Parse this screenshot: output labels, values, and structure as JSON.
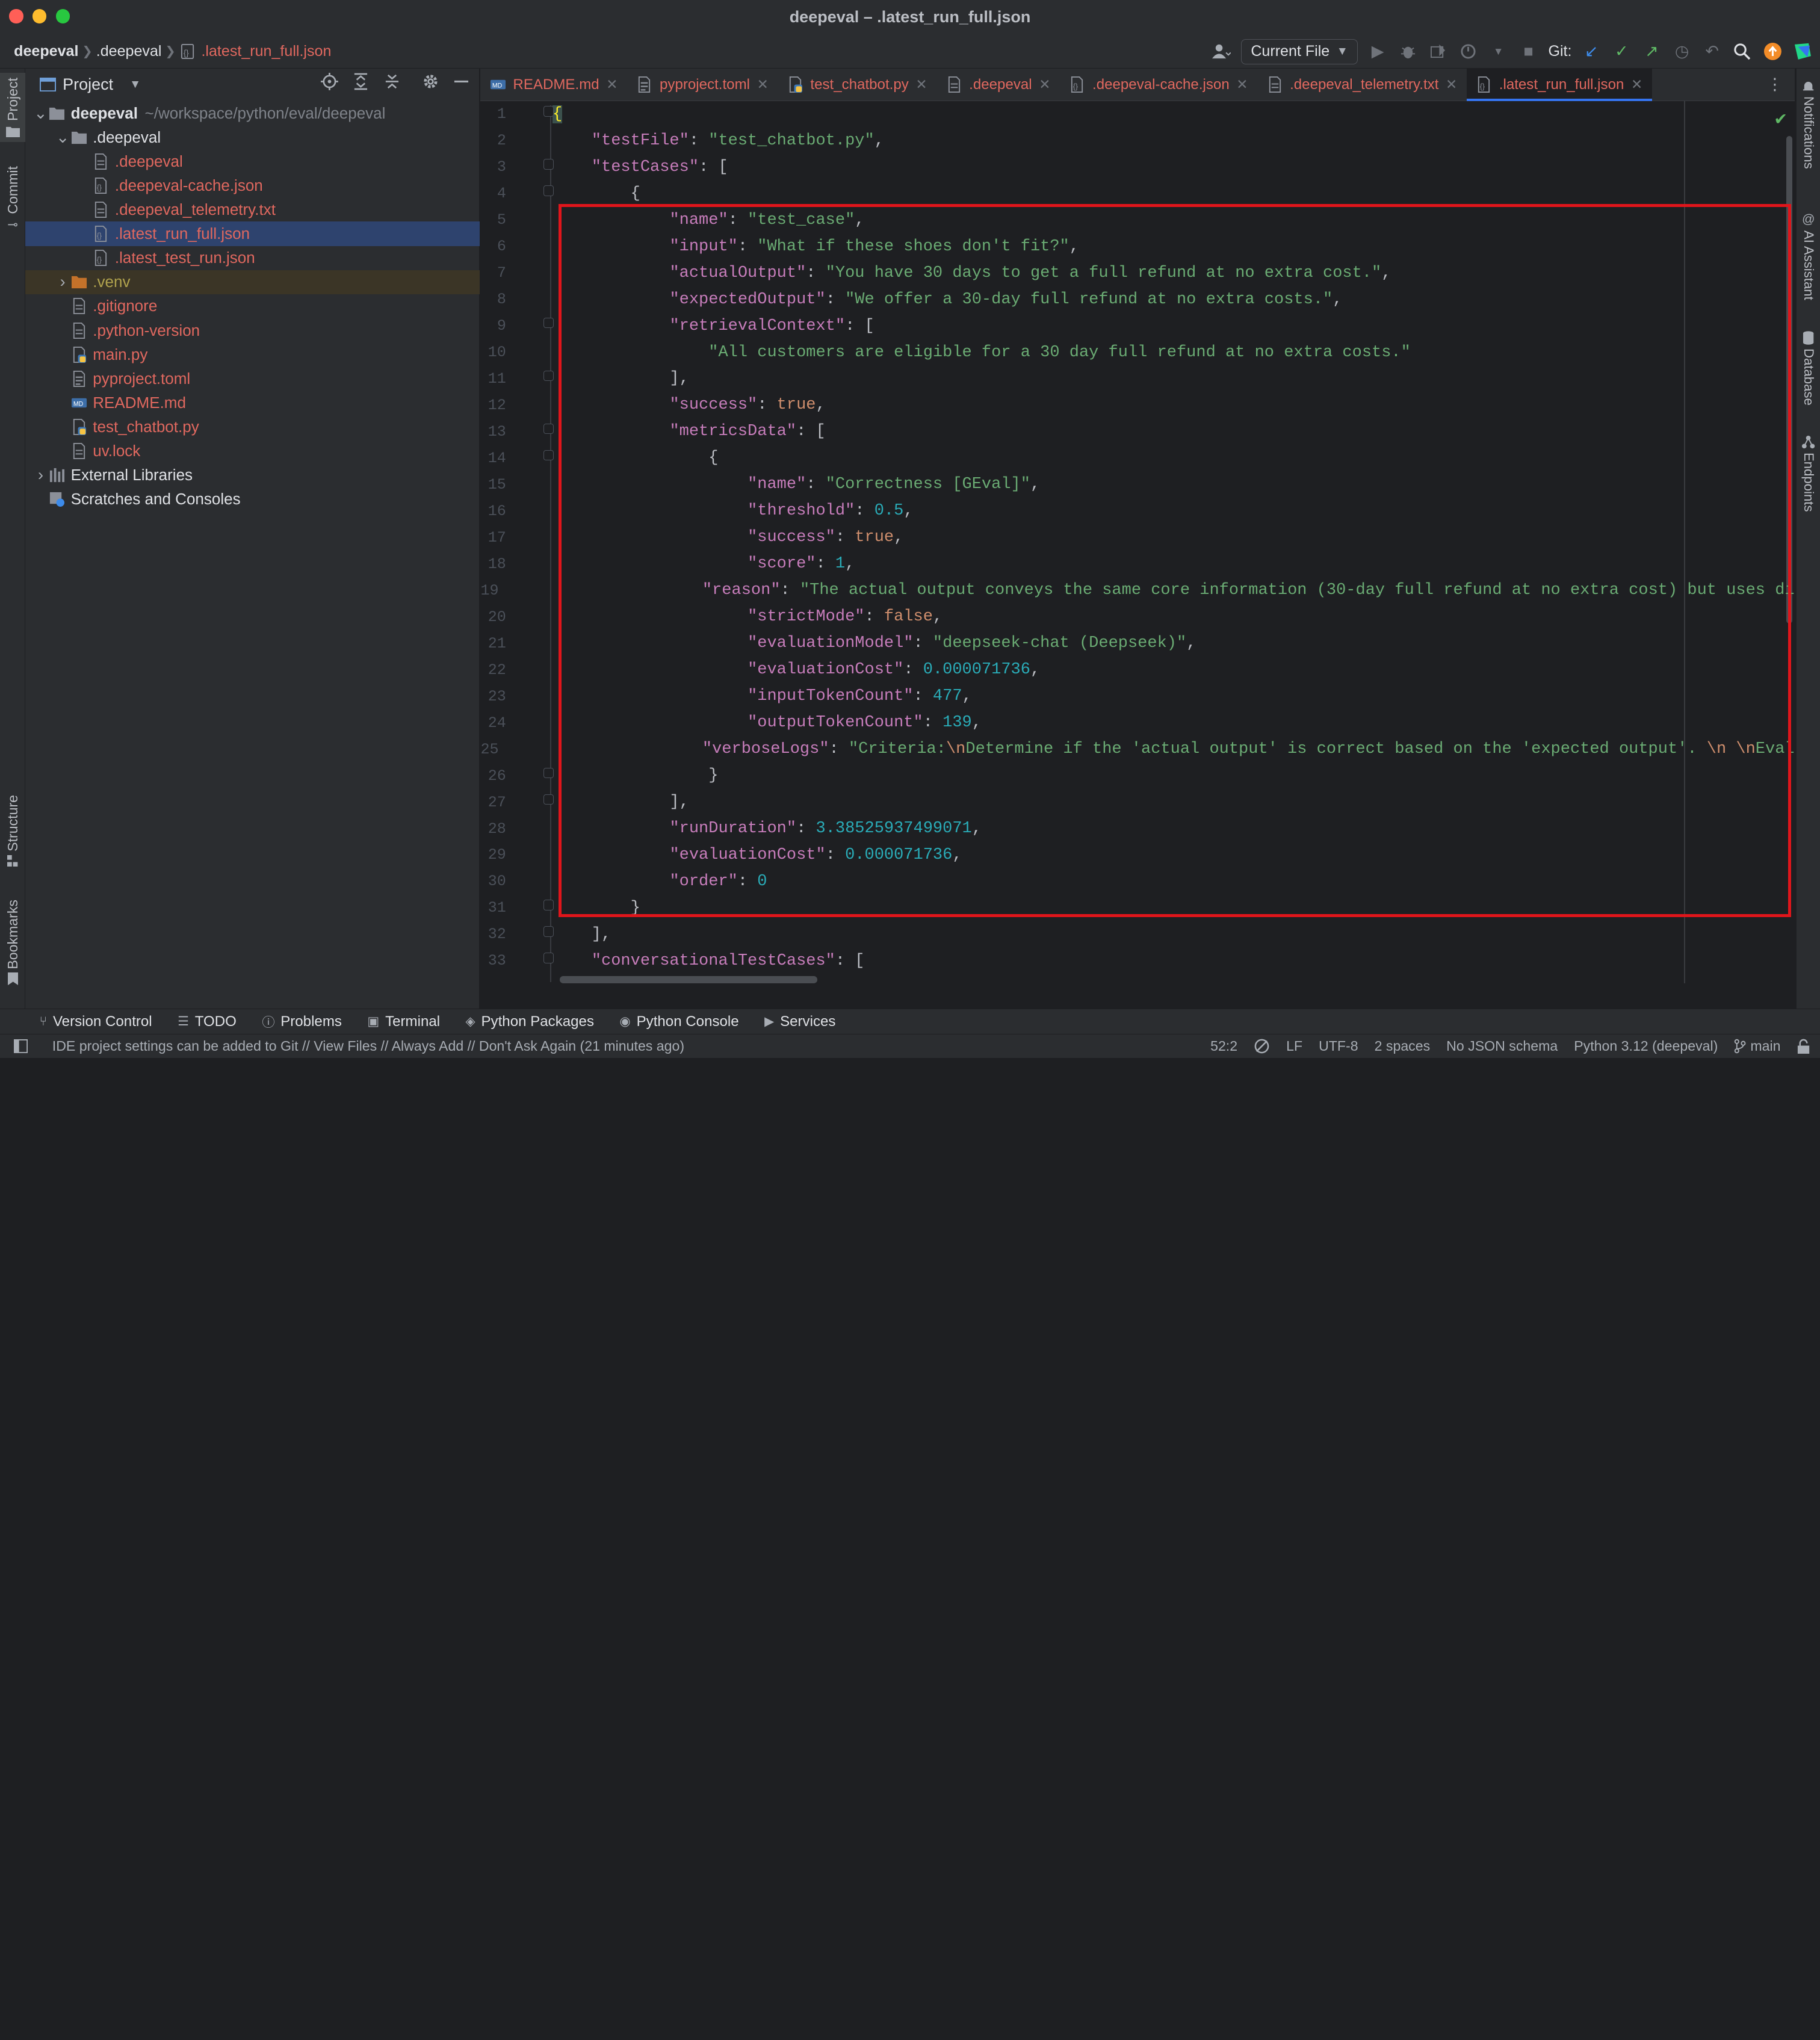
{
  "window": {
    "title": "deepeval – .latest_run_full.json"
  },
  "breadcrumb": {
    "root": "deepeval",
    "folder": ".deepeval",
    "file": ".latest_run_full.json"
  },
  "toolbar": {
    "run_config": "Current File",
    "git_label": "Git:"
  },
  "left_strip": {
    "project": "Project",
    "commit": "Commit",
    "structure": "Structure",
    "bookmarks": "Bookmarks"
  },
  "right_strip": {
    "notifications": "Notifications",
    "ai_assistant": "AI Assistant",
    "database": "Database",
    "endpoints": "Endpoints"
  },
  "project_panel": {
    "title": "Project",
    "tree": [
      {
        "name": "deepeval",
        "path": "~/workspace/python/eval/deepeval",
        "kind": "folder",
        "expanded": true,
        "depth": 0
      },
      {
        "name": ".deepeval",
        "kind": "folder",
        "expanded": true,
        "depth": 1
      },
      {
        "name": ".deepeval",
        "kind": "file",
        "depth": 2
      },
      {
        "name": ".deepeval-cache.json",
        "kind": "json",
        "depth": 2
      },
      {
        "name": ".deepeval_telemetry.txt",
        "kind": "file",
        "depth": 2
      },
      {
        "name": ".latest_run_full.json",
        "kind": "json",
        "depth": 2,
        "selected": true
      },
      {
        "name": ".latest_test_run.json",
        "kind": "json",
        "depth": 2
      },
      {
        "name": ".venv",
        "kind": "folder-excluded",
        "expanded": false,
        "depth": 1
      },
      {
        "name": ".gitignore",
        "kind": "file",
        "depth": 1
      },
      {
        "name": ".python-version",
        "kind": "file",
        "depth": 1
      },
      {
        "name": "main.py",
        "kind": "python",
        "depth": 1
      },
      {
        "name": "pyproject.toml",
        "kind": "toml",
        "depth": 1
      },
      {
        "name": "README.md",
        "kind": "md",
        "depth": 1
      },
      {
        "name": "test_chatbot.py",
        "kind": "python",
        "depth": 1
      },
      {
        "name": "uv.lock",
        "kind": "file",
        "depth": 1
      },
      {
        "name": "External Libraries",
        "kind": "library",
        "expanded": false,
        "depth": 0
      },
      {
        "name": "Scratches and Consoles",
        "kind": "scratch",
        "depth": 0
      }
    ]
  },
  "tabs": [
    {
      "label": "README.md",
      "icon": "markdown-icon"
    },
    {
      "label": "pyproject.toml",
      "icon": "toml-icon"
    },
    {
      "label": "test_chatbot.py",
      "icon": "python-icon"
    },
    {
      "label": ".deepeval",
      "icon": "file-icon"
    },
    {
      "label": ".deepeval-cache.json",
      "icon": "json-icon"
    },
    {
      "label": ".deepeval_telemetry.txt",
      "icon": "text-file-icon"
    },
    {
      "label": ".latest_run_full.json",
      "icon": "json-icon",
      "active": true
    }
  ],
  "code_lines": [
    [
      [
        "brace-hl",
        "{"
      ]
    ],
    [
      [
        "t",
        "    "
      ],
      [
        "k",
        "\"testFile\""
      ],
      [
        "t",
        ": "
      ],
      [
        "s",
        "\"test_chatbot.py\""
      ],
      [
        "t",
        ","
      ]
    ],
    [
      [
        "t",
        "    "
      ],
      [
        "k",
        "\"testCases\""
      ],
      [
        "t",
        ": ["
      ]
    ],
    [
      [
        "t",
        "        {"
      ]
    ],
    [
      [
        "t",
        "            "
      ],
      [
        "k",
        "\"name\""
      ],
      [
        "t",
        ": "
      ],
      [
        "s",
        "\"test_case\""
      ],
      [
        "t",
        ","
      ]
    ],
    [
      [
        "t",
        "            "
      ],
      [
        "k",
        "\"input\""
      ],
      [
        "t",
        ": "
      ],
      [
        "s",
        "\"What if these shoes don't fit?\""
      ],
      [
        "t",
        ","
      ]
    ],
    [
      [
        "t",
        "            "
      ],
      [
        "k",
        "\"actualOutput\""
      ],
      [
        "t",
        ": "
      ],
      [
        "s",
        "\"You have 30 days to get a full refund at no extra cost.\""
      ],
      [
        "t",
        ","
      ]
    ],
    [
      [
        "t",
        "            "
      ],
      [
        "k",
        "\"expectedOutput\""
      ],
      [
        "t",
        ": "
      ],
      [
        "s",
        "\"We offer a 30-day full refund at no extra costs.\""
      ],
      [
        "t",
        ","
      ]
    ],
    [
      [
        "t",
        "            "
      ],
      [
        "k",
        "\"retrievalContext\""
      ],
      [
        "t",
        ": ["
      ]
    ],
    [
      [
        "t",
        "                "
      ],
      [
        "s",
        "\"All customers are eligible for a 30 day full refund at no extra costs.\""
      ]
    ],
    [
      [
        "t",
        "            ],"
      ]
    ],
    [
      [
        "t",
        "            "
      ],
      [
        "k",
        "\"success\""
      ],
      [
        "t",
        ": "
      ],
      [
        "b",
        "true"
      ],
      [
        "t",
        ","
      ]
    ],
    [
      [
        "t",
        "            "
      ],
      [
        "k",
        "\"metricsData\""
      ],
      [
        "t",
        ": ["
      ]
    ],
    [
      [
        "t",
        "                {"
      ]
    ],
    [
      [
        "t",
        "                    "
      ],
      [
        "k",
        "\"name\""
      ],
      [
        "t",
        ": "
      ],
      [
        "s",
        "\"Correctness [GEval]\""
      ],
      [
        "t",
        ","
      ]
    ],
    [
      [
        "t",
        "                    "
      ],
      [
        "k",
        "\"threshold\""
      ],
      [
        "t",
        ": "
      ],
      [
        "n",
        "0.5"
      ],
      [
        "t",
        ","
      ]
    ],
    [
      [
        "t",
        "                    "
      ],
      [
        "k",
        "\"success\""
      ],
      [
        "t",
        ": "
      ],
      [
        "b",
        "true"
      ],
      [
        "t",
        ","
      ]
    ],
    [
      [
        "t",
        "                    "
      ],
      [
        "k",
        "\"score\""
      ],
      [
        "t",
        ": "
      ],
      [
        "n",
        "1"
      ],
      [
        "t",
        ","
      ]
    ],
    [
      [
        "t",
        "                    "
      ],
      [
        "k",
        "\"reason\""
      ],
      [
        "t",
        ": "
      ],
      [
        "s",
        "\"The actual output conveys the same core information (30-day full refund at no extra cost) but uses di"
      ]
    ],
    [
      [
        "t",
        "                    "
      ],
      [
        "k",
        "\"strictMode\""
      ],
      [
        "t",
        ": "
      ],
      [
        "b",
        "false"
      ],
      [
        "t",
        ","
      ]
    ],
    [
      [
        "t",
        "                    "
      ],
      [
        "k",
        "\"evaluationModel\""
      ],
      [
        "t",
        ": "
      ],
      [
        "s",
        "\"deepseek-chat (Deepseek)\""
      ],
      [
        "t",
        ","
      ]
    ],
    [
      [
        "t",
        "                    "
      ],
      [
        "k",
        "\"evaluationCost\""
      ],
      [
        "t",
        ": "
      ],
      [
        "n",
        "0.000071736"
      ],
      [
        "t",
        ","
      ]
    ],
    [
      [
        "t",
        "                    "
      ],
      [
        "k",
        "\"inputTokenCount\""
      ],
      [
        "t",
        ": "
      ],
      [
        "n",
        "477"
      ],
      [
        "t",
        ","
      ]
    ],
    [
      [
        "t",
        "                    "
      ],
      [
        "k",
        "\"outputTokenCount\""
      ],
      [
        "t",
        ": "
      ],
      [
        "n",
        "139"
      ],
      [
        "t",
        ","
      ]
    ],
    [
      [
        "t",
        "                    "
      ],
      [
        "k",
        "\"verboseLogs\""
      ],
      [
        "t",
        ": "
      ],
      [
        "s",
        "\"Criteria:"
      ],
      [
        "esc",
        "\\n"
      ],
      [
        "s",
        "Determine if the 'actual output' is correct based on the 'expected output'. "
      ],
      [
        "esc",
        "\\n \\n"
      ],
      [
        "s",
        "Eval"
      ]
    ],
    [
      [
        "t",
        "                }"
      ]
    ],
    [
      [
        "t",
        "            ],"
      ]
    ],
    [
      [
        "t",
        "            "
      ],
      [
        "k",
        "\"runDuration\""
      ],
      [
        "t",
        ": "
      ],
      [
        "n",
        "3.38525937499071"
      ],
      [
        "t",
        ","
      ]
    ],
    [
      [
        "t",
        "            "
      ],
      [
        "k",
        "\"evaluationCost\""
      ],
      [
        "t",
        ": "
      ],
      [
        "n",
        "0.000071736"
      ],
      [
        "t",
        ","
      ]
    ],
    [
      [
        "t",
        "            "
      ],
      [
        "k",
        "\"order\""
      ],
      [
        "t",
        ": "
      ],
      [
        "n",
        "0"
      ]
    ],
    [
      [
        "t",
        "        }"
      ]
    ],
    [
      [
        "t",
        "    ],"
      ]
    ],
    [
      [
        "t",
        "    "
      ],
      [
        "k",
        "\"conversationalTestCases\""
      ],
      [
        "t",
        ": ["
      ]
    ]
  ],
  "tool_windows": [
    {
      "label": "Version Control",
      "icon": "branch-icon"
    },
    {
      "label": "TODO",
      "icon": "list-icon"
    },
    {
      "label": "Problems",
      "icon": "info-icon"
    },
    {
      "label": "Terminal",
      "icon": "terminal-icon"
    },
    {
      "label": "Python Packages",
      "icon": "packages-icon"
    },
    {
      "label": "Python Console",
      "icon": "python-console-icon"
    },
    {
      "label": "Services",
      "icon": "services-icon"
    }
  ],
  "status": {
    "message": "IDE project settings can be added to Git // View Files // Always Add // Don't Ask Again (21 minutes ago)",
    "position": "52:2",
    "line_ending": "LF",
    "encoding": "UTF-8",
    "indent": "2 spaces",
    "schema": "No JSON schema",
    "interpreter": "Python 3.12 (deepeval)",
    "branch": "main"
  },
  "colors": {
    "accent": "#3574f0",
    "annotation": "#e0151b",
    "modified_file": "#e0685f"
  }
}
